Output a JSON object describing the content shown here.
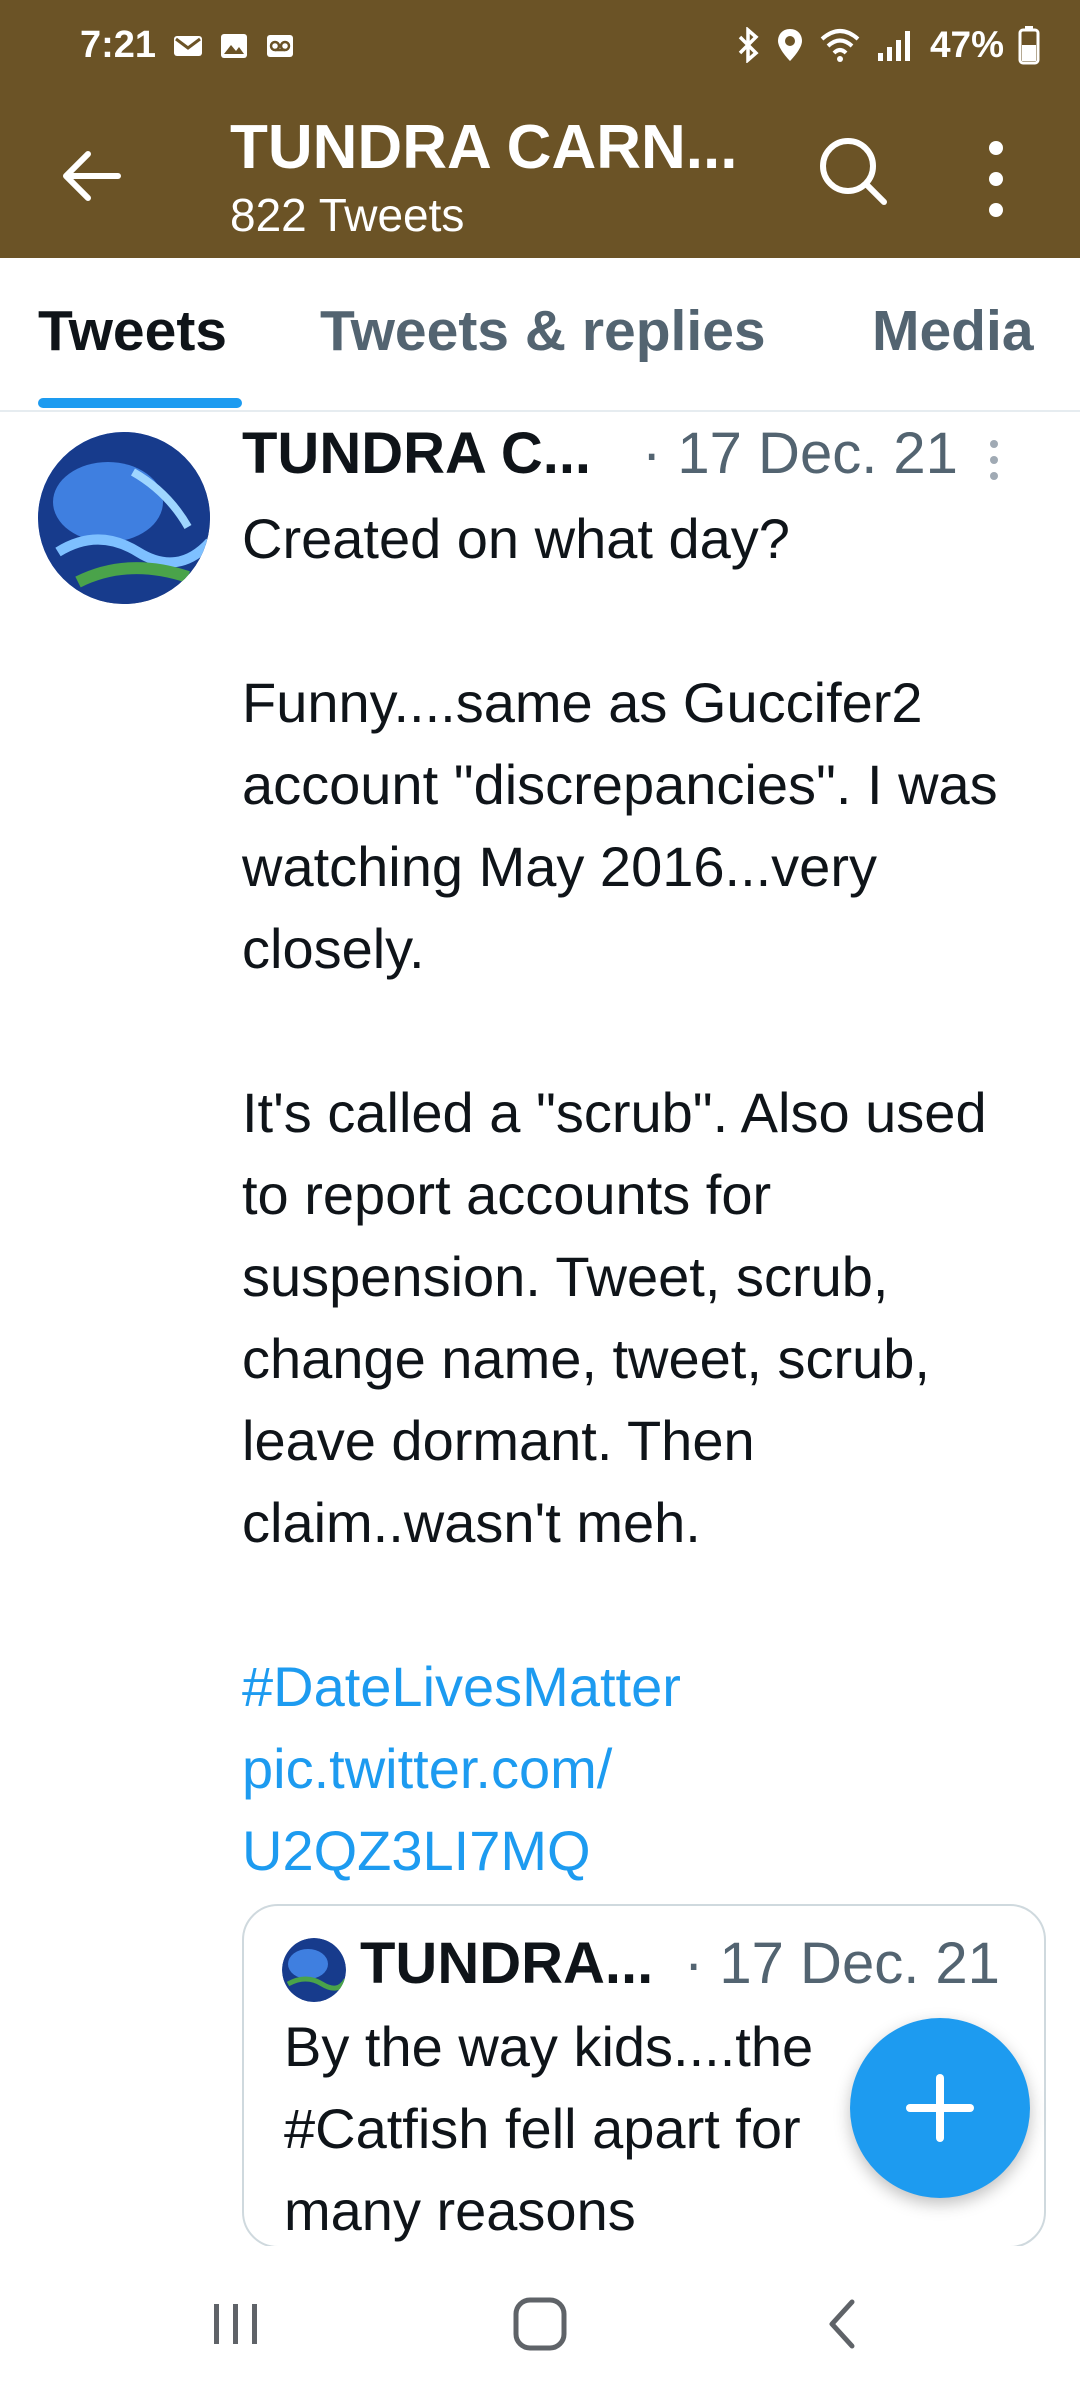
{
  "status_bar": {
    "time": "7:21",
    "left_icons": [
      "gmail-icon",
      "gallery-icon",
      "voicemail-icon"
    ],
    "right_icons": [
      "bluetooth-icon",
      "location-icon",
      "wifi-icon",
      "signal-icon",
      "battery-icon"
    ],
    "battery": "47%"
  },
  "app_bar": {
    "title": "TUNDRA CARN...",
    "subtitle": "822 Tweets"
  },
  "tabs": [
    {
      "label": "Tweets",
      "active": true
    },
    {
      "label": "Tweets & replies",
      "active": false
    },
    {
      "label": "Media",
      "active": false
    }
  ],
  "tweet": {
    "author": "TUNDRA C...",
    "date": "· 17 Dec. 21",
    "paragraphs": [
      "Created on what day?",
      "Funny....same as Guccifer2 account \"discrepancies\". I was watching May 2016...very closely.",
      "It's called a \"scrub\". Also used to report accounts for suspension. Tweet, scrub, change name, tweet, scrub, leave dormant. Then claim..wasn't meh."
    ],
    "hashtag": "#DateLivesMatter",
    "link_line1": "pic.twitter.com/",
    "link_line2": "U2QZ3LI7MQ"
  },
  "quoted_tweet": {
    "author": "TUNDRA...",
    "date": "· 17 Dec. 21",
    "text_line1": "By the way kids....the",
    "text_line2": "#Catfish fell apart for",
    "text_line3": "many reasons"
  },
  "fab": {
    "icon": "plus-icon"
  },
  "nav_bar": {
    "buttons": [
      "recents-icon",
      "home-icon",
      "back-icon"
    ]
  },
  "colors": {
    "header_bg": "#6b5326",
    "accent": "#1d9bf0",
    "text": "#0f1419",
    "secondary_text": "#536471"
  }
}
